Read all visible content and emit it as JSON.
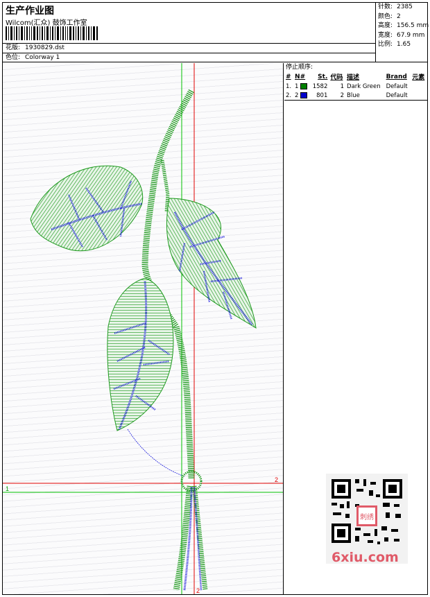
{
  "header": {
    "title": "生产作业图",
    "studio": "Wilcom(汇众) 鼓饰工作室",
    "file_label": "花版:",
    "file_value": "1930829.dst",
    "colorway_label": "色位:",
    "colorway_value": "Colorway 1"
  },
  "stats": [
    {
      "key": "针数:",
      "value": "2385"
    },
    {
      "key": "颜色:",
      "value": "2"
    },
    {
      "key": "高度:",
      "value": "156.5 mm"
    },
    {
      "key": "宽度:",
      "value": "67.9 mm"
    },
    {
      "key": "比例:",
      "value": "1.65"
    }
  ],
  "stop_sequence": {
    "title": "停止顺序:",
    "columns": [
      "#",
      "N#",
      "St.",
      "代码",
      "描述",
      "Brand",
      "元素"
    ],
    "rows": [
      {
        "n": "1.",
        "nn": "1",
        "color": "#008000",
        "st": "1582",
        "code": "1",
        "desc": "Dark Green",
        "brand": "Default"
      },
      {
        "n": "2.",
        "nn": "2",
        "color": "#0000cc",
        "st": "801",
        "code": "2",
        "desc": "Blue",
        "brand": "Default"
      }
    ]
  },
  "markers": {
    "left_one": "1",
    "right_two": "2",
    "bottom_two": "2"
  },
  "colors": {
    "thread_green": "#1f9a1f",
    "thread_blue": "#1a1adb",
    "guide_red": "#e00000",
    "guide_green": "#00c000",
    "brand_pink": "#e05a68"
  },
  "watermark": {
    "brand_text": "6xiu.com",
    "qr_center_text": "刺绣"
  }
}
